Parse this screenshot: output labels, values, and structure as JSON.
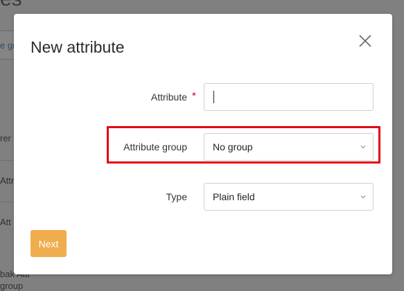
{
  "background": {
    "heading_fragment": "es",
    "link_fragment": "e gr",
    "fragments": [
      "rer",
      "Attr",
      "Att",
      "bak Attr",
      "group"
    ]
  },
  "modal": {
    "title": "New attribute",
    "close_icon": "close-icon",
    "fields": {
      "attribute": {
        "label": "Attribute",
        "required_marker": "*",
        "value": ""
      },
      "attribute_group": {
        "label": "Attribute group",
        "value": "No group"
      },
      "type": {
        "label": "Type",
        "value": "Plain field"
      }
    },
    "next_label": "Next"
  },
  "colors": {
    "accent_button": "#f0ad4e",
    "required": "#d0021b",
    "highlight": "#e30613",
    "overlay": "#808080"
  }
}
